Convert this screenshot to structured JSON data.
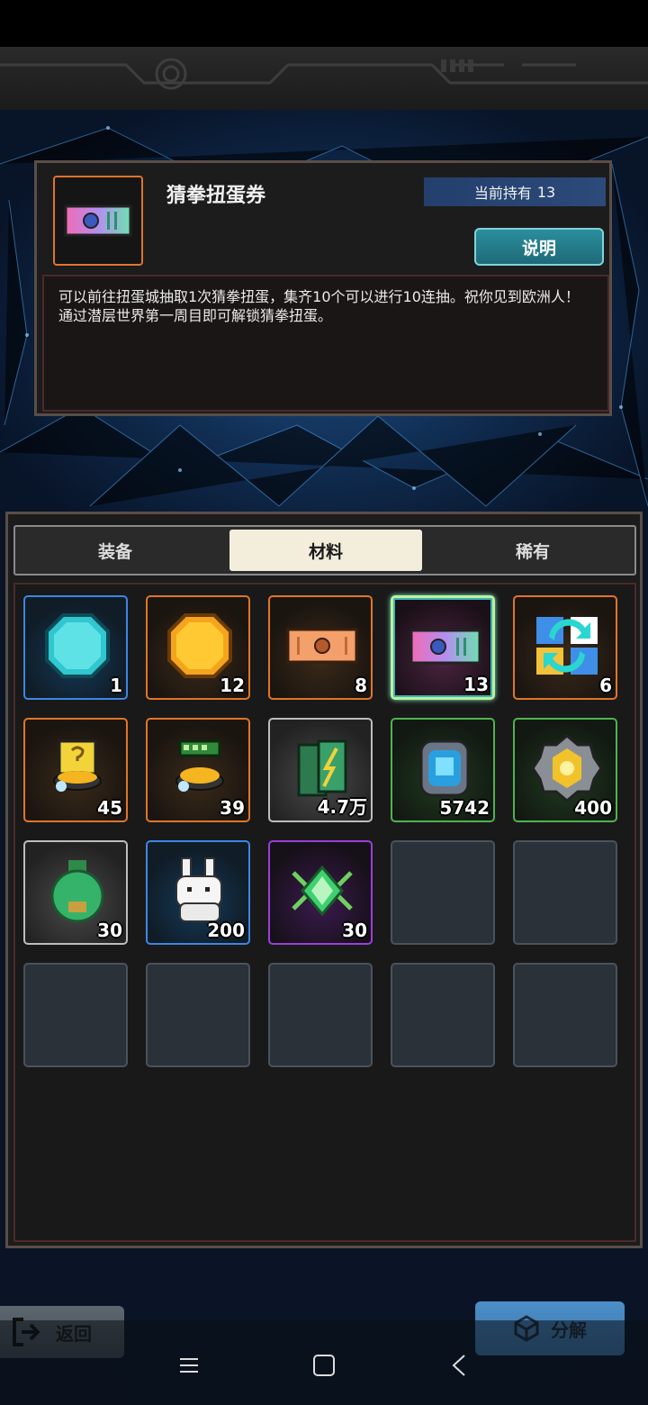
{
  "item_detail": {
    "name": "猜拳扭蛋券",
    "holding_label": "当前持有",
    "holding_count": "13",
    "explain_button": "说明",
    "description": "可以前往扭蛋城抽取1次猜拳扭蛋，集齐10个可以进行10连抽。祝你见到欧洲人！通过潜层世界第一周目即可解锁猜拳扭蛋。"
  },
  "tabs": [
    {
      "label": "装备",
      "active": false
    },
    {
      "label": "材料",
      "active": true
    },
    {
      "label": "稀有",
      "active": false
    }
  ],
  "slots": [
    {
      "icon": "cyan-gem-icon",
      "count": "1",
      "rarity": "blue"
    },
    {
      "icon": "gold-coin-icon",
      "count": "12",
      "rarity": "orange"
    },
    {
      "icon": "orange-ticket-icon",
      "count": "8",
      "rarity": "orange"
    },
    {
      "icon": "rainbow-ticket-icon",
      "count": "13",
      "rarity": "selected"
    },
    {
      "icon": "cycle-puzzle-icon",
      "count": "6",
      "rarity": "orange"
    },
    {
      "icon": "gold-box-icon",
      "count": "45",
      "rarity": "orange"
    },
    {
      "icon": "chip-box-icon",
      "count": "39",
      "rarity": "orange"
    },
    {
      "icon": "battery-icon",
      "count": "4.7万",
      "rarity": "silver"
    },
    {
      "icon": "blue-core-icon",
      "count": "5742",
      "rarity": "green"
    },
    {
      "icon": "gold-gear-core-icon",
      "count": "400",
      "rarity": "green"
    },
    {
      "icon": "green-potion-jar-icon",
      "count": "30",
      "rarity": "silver"
    },
    {
      "icon": "white-bunny-icon",
      "count": "200",
      "rarity": "blue"
    },
    {
      "icon": "green-crystal-icon",
      "count": "30",
      "rarity": "purple"
    }
  ],
  "bottom": {
    "back_label": "返回",
    "decompose_label": "分解"
  },
  "nav": [
    "menu-icon",
    "home-icon",
    "back-arrow-icon"
  ]
}
